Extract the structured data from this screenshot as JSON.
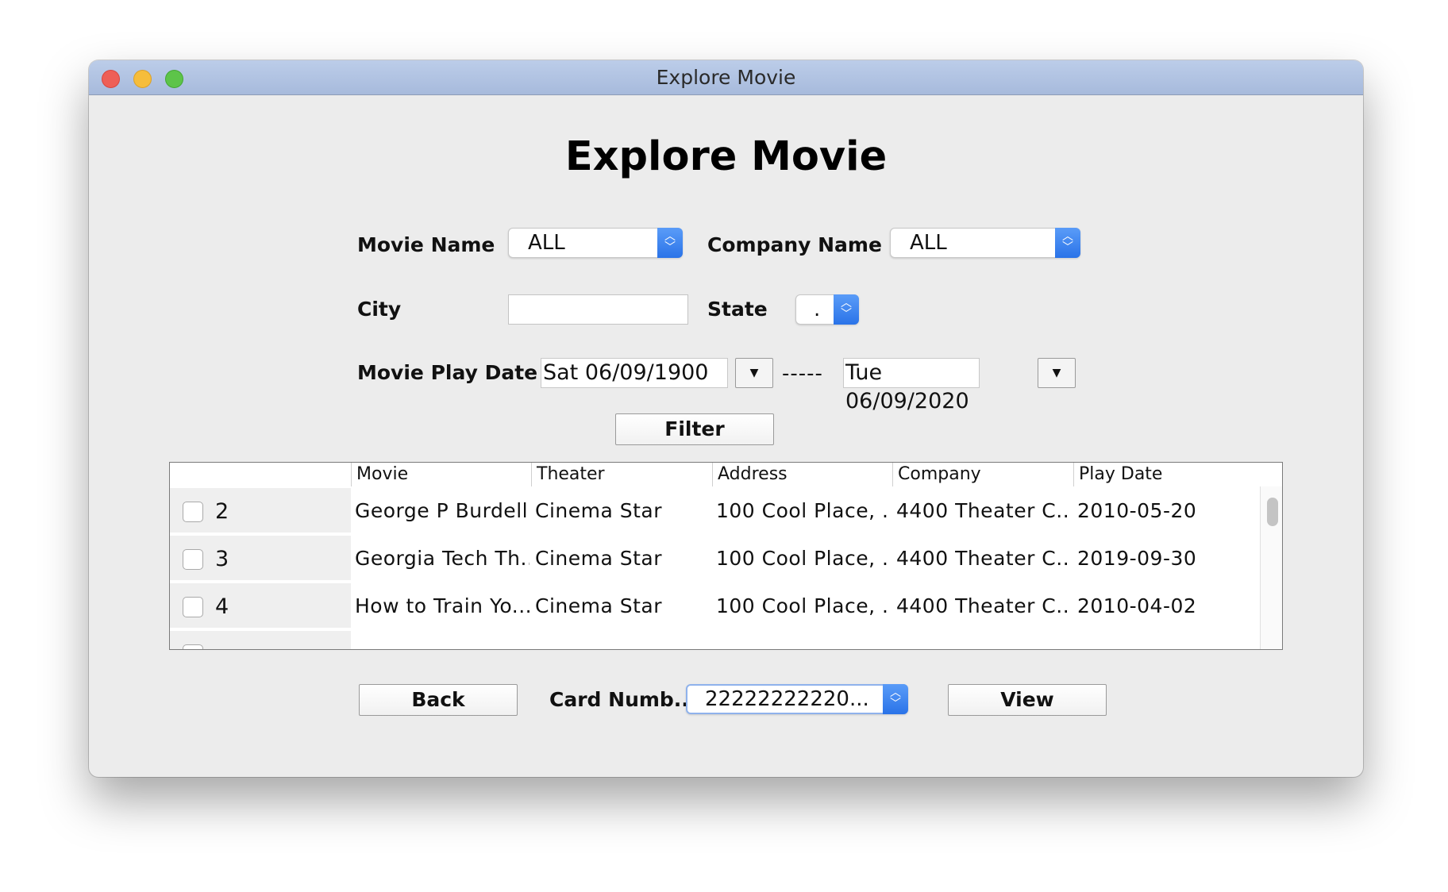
{
  "window": {
    "title": "Explore Movie"
  },
  "heading": "Explore Movie",
  "filters": {
    "movie_name_label": "Movie Name",
    "movie_name_value": "ALL",
    "company_name_label": "Company Name",
    "company_name_value": "ALL",
    "city_label": "City",
    "city_value": "",
    "state_label": "State",
    "state_value": ".",
    "play_date_label": "Movie Play Date",
    "date_from": "Sat 06/09/1900",
    "date_separator": "-----",
    "date_to": "Tue 06/09/2020",
    "dropdown_glyph": "▼"
  },
  "filter_button": "Filter",
  "table": {
    "columns": [
      "",
      "Movie",
      "Theater",
      "Address",
      "Company",
      "Play Date"
    ],
    "rows": [
      {
        "num": "2",
        "movie": "George P Burdell...",
        "theater": "Cinema Star",
        "address": "100 Cool Place, ...",
        "company": "4400 Theater C...",
        "play_date": "2010-05-20"
      },
      {
        "num": "3",
        "movie": "Georgia Tech Th...",
        "theater": "Cinema Star",
        "address": "100 Cool Place, ...",
        "company": "4400 Theater C...",
        "play_date": "2019-09-30"
      },
      {
        "num": "4",
        "movie": "How to Train Yo...",
        "theater": "Cinema Star",
        "address": "100 Cool Place, ...",
        "company": "4400 Theater C...",
        "play_date": "2010-04-02"
      }
    ]
  },
  "bottom": {
    "back_label": "Back",
    "card_label": "Card Numb...",
    "card_value": "22222222220...",
    "view_label": "View"
  }
}
